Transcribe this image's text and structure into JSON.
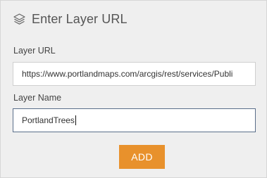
{
  "header": {
    "icon": "layers-icon",
    "title": "Enter Layer URL"
  },
  "layer_url": {
    "label": "Layer URL",
    "value": "https://www.portlandmaps.com/arcgis/rest/services/Publi"
  },
  "layer_name": {
    "label": "Layer Name",
    "value": "PortlandTrees"
  },
  "actions": {
    "add_label": "ADD"
  },
  "colors": {
    "panel_bg": "#efefef",
    "button_bg": "#e8912c",
    "active_border": "#5a6e8a"
  }
}
